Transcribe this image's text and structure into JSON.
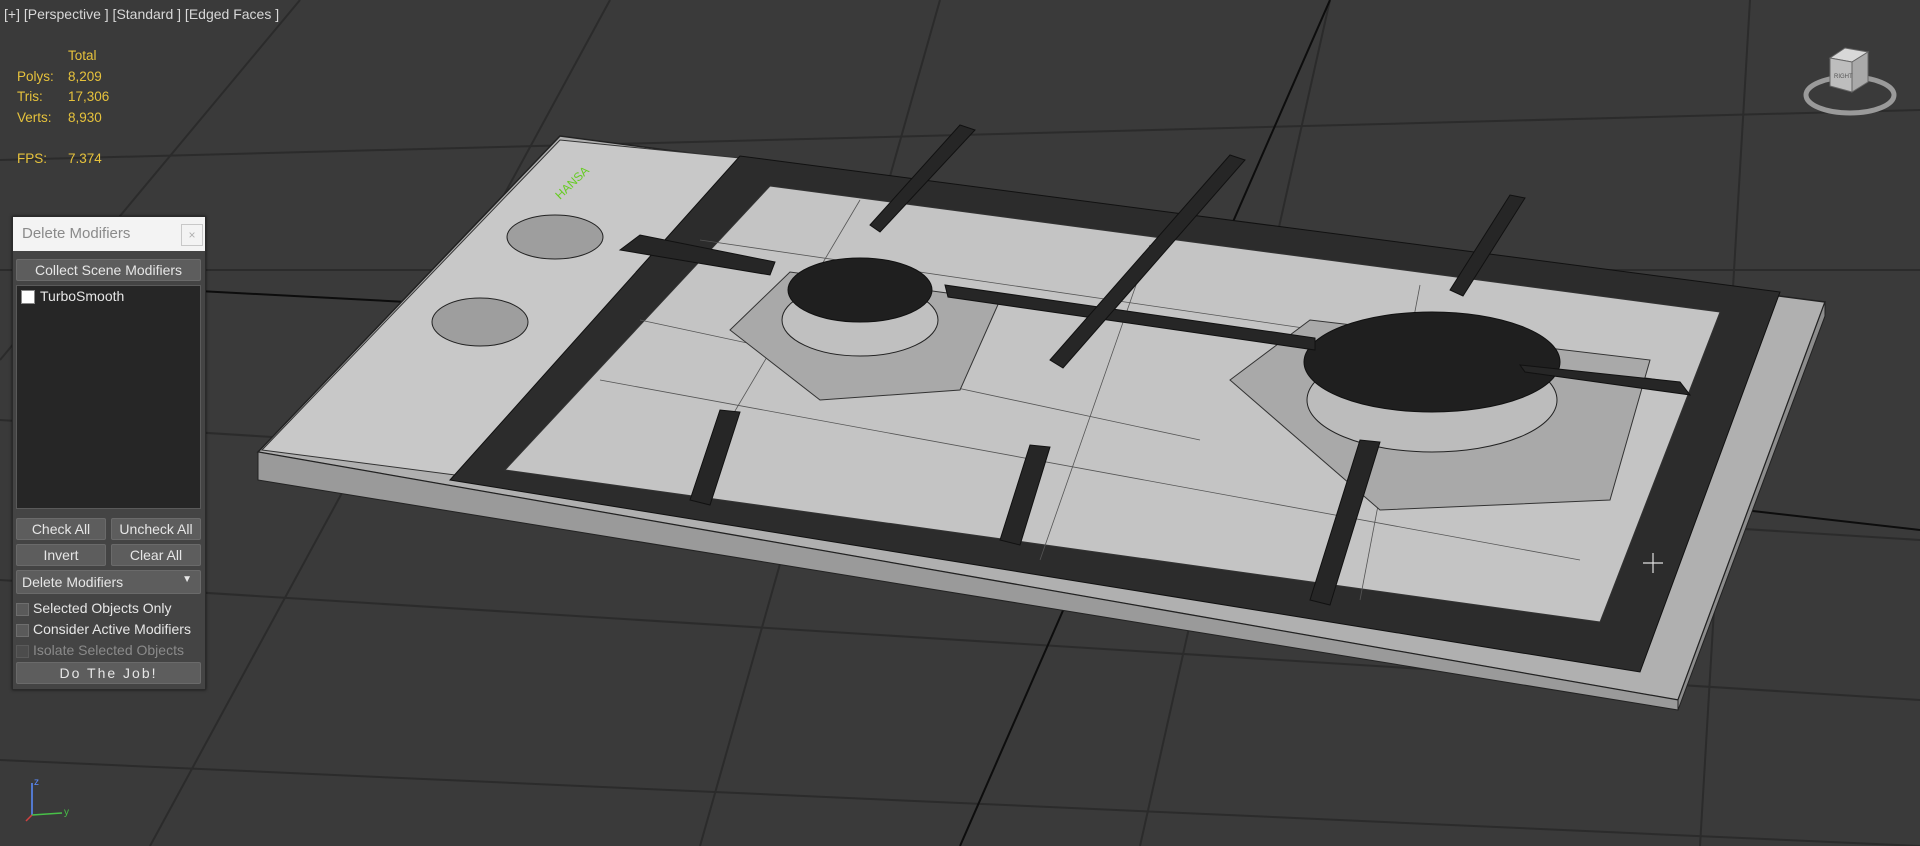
{
  "viewport": {
    "label": "[+] [Perspective ] [Standard ] [Edged Faces ]",
    "background": "#3a3a3a",
    "grid_color": "#2b2b2b"
  },
  "stats": {
    "header": "Total",
    "rows": [
      {
        "label": "Polys:",
        "value": "8,209"
      },
      {
        "label": "Tris:",
        "value": "17,306"
      },
      {
        "label": "Verts:",
        "value": "8,930"
      }
    ],
    "fps_label": "FPS:",
    "fps_value": "7.374",
    "color": "#e6c23c"
  },
  "nav_cube": {
    "face_label": "RIGHT"
  },
  "axis_gizmo": {
    "z": "z",
    "y": "y"
  },
  "model": {
    "brand_text": "HANSA",
    "brand_color": "#66cc22"
  },
  "dialog": {
    "title": "Delete Modifiers",
    "close": "×",
    "collect_button": "Collect Scene Modifiers",
    "modifiers": [
      {
        "label": "TurboSmooth",
        "checked": false
      }
    ],
    "check_all": "Check All",
    "uncheck_all": "Uncheck All",
    "invert": "Invert",
    "clear_all": "Clear All",
    "mode_select": "Delete Modifiers",
    "options": [
      {
        "label": "Selected Objects Only",
        "enabled": true
      },
      {
        "label": "Consider Active Modifiers",
        "enabled": true
      },
      {
        "label": "Isolate Selected Objects",
        "enabled": false
      }
    ],
    "run_button": "Do The Job!"
  }
}
